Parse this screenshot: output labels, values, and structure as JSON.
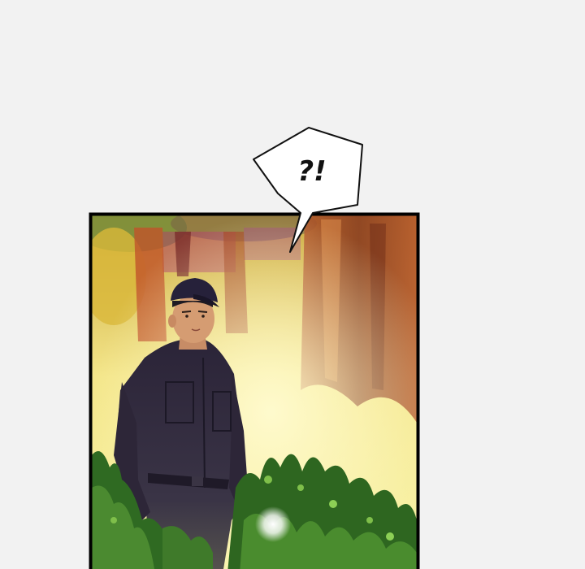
{
  "speech_bubble": {
    "text": "?!"
  },
  "panel": {
    "description_colors": {
      "border": "#000000",
      "page_background": "#f2f2f2",
      "uniform": "#2f2a3c",
      "foliage": "#3f7a2a",
      "glow": "#f6ee7a"
    }
  }
}
